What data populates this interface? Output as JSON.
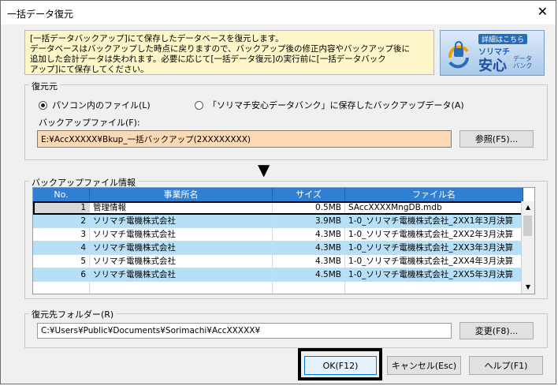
{
  "window": {
    "title": "一括データ復元",
    "close_glyph": "✕"
  },
  "notice": {
    "text": "[一括データバックアップ]にて保存したデータベースを復元します。\nデータベースはバックアップした時点に戻りますので、バックアップ後の修正内容やバックアップ後に\n追加した会計データは失われます。必要に応じて[一括データ復元]の実行前に[一括データバック\nアップ]にて保存してください。"
  },
  "banner": {
    "head": "詳細はこちら",
    "line1": "ソリマチ",
    "line2": "安心",
    "line3": "データ\nバンク"
  },
  "source": {
    "group_label": "復元元",
    "radio_pc": "パソコン内のファイル(L)",
    "radio_bank": "「ソリマチ安心データバンク」に保存したバックアップデータ(A)",
    "file_label": "バックアップファイル(F):",
    "file_value": "E:¥AccXXXXX¥Bkup_一括バックアップ(2XXXXXXXX)",
    "browse_button": "参照(F5)..."
  },
  "arrow": "▼",
  "backup_info": {
    "group_label": "バックアップファイル情報",
    "columns": [
      "No.",
      "事業所名",
      "サイズ",
      "ファイル名"
    ],
    "rows": [
      {
        "no": "1",
        "name": "管理情報",
        "size": "0.5MB",
        "file": "SAccXXXXMngDB.mdb"
      },
      {
        "no": "2",
        "name": "ソリマチ電機株式会社",
        "size": "3.9MB",
        "file": "1-0_ソリマチ電機株式会社_2XX1年3月決算"
      },
      {
        "no": "3",
        "name": "ソリマチ電機株式会社",
        "size": "4.3MB",
        "file": "1-0_ソリマチ電機株式会社_2XX2年3月決算"
      },
      {
        "no": "4",
        "name": "ソリマチ電機株式会社",
        "size": "4.3MB",
        "file": "1-0_ソリマチ電機株式会社_2XX3年3月決算"
      },
      {
        "no": "5",
        "name": "ソリマチ電機株式会社",
        "size": "4.3MB",
        "file": "1-0_ソリマチ電機株式会社_2XX4年3月決算"
      },
      {
        "no": "6",
        "name": "ソリマチ電機株式会社",
        "size": "4.5MB",
        "file": "1-0_ソリマチ電機株式会社_2XX5年3月決算"
      },
      {
        "no": "",
        "name": "",
        "size": "",
        "file": ""
      }
    ],
    "scroll_up": "▲",
    "scroll_down": "▼"
  },
  "dest": {
    "group_label": "復元先フォルダー(R)",
    "path_value": "C:¥Users¥Public¥Documents¥Sorimachi¥AccXXXXX¥",
    "change_button": "変更(F8)..."
  },
  "footer": {
    "ok": "OK(F12)",
    "cancel": "キャンセル(Esc)",
    "help": "ヘルプ(F1)"
  }
}
